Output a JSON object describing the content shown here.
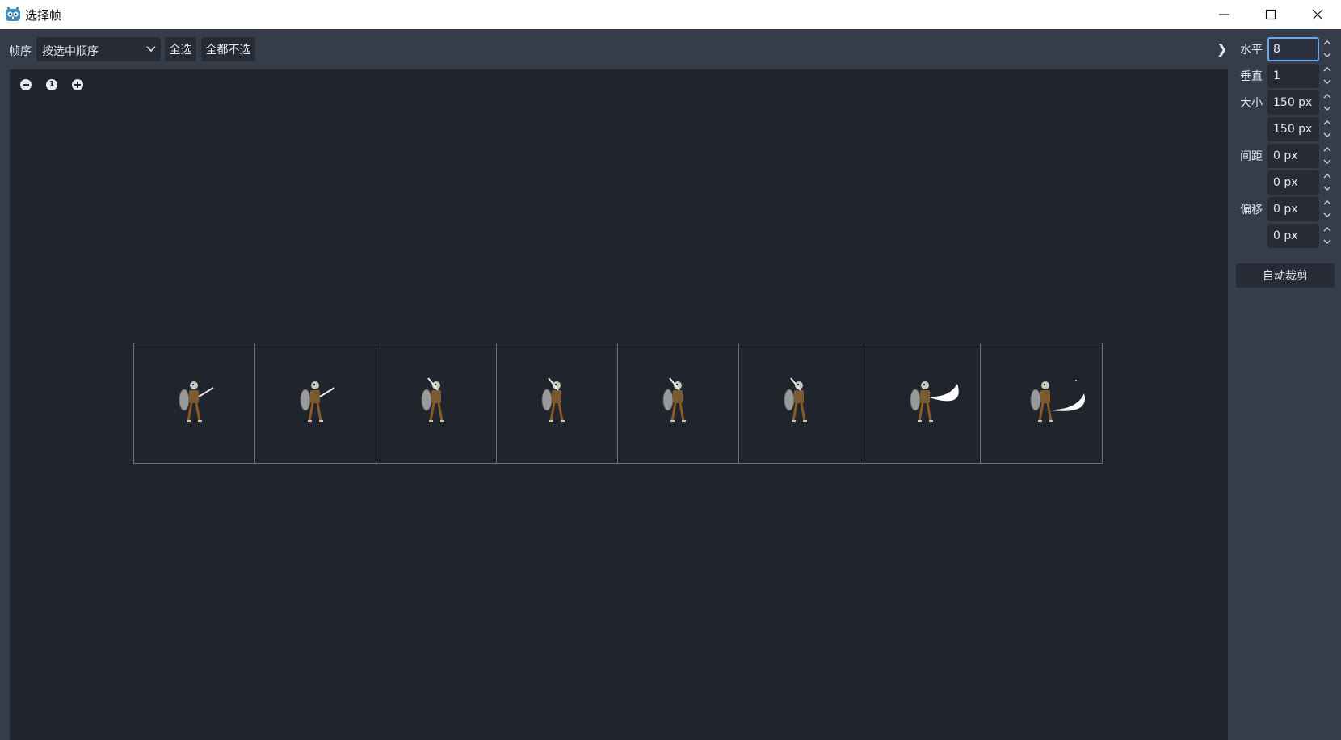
{
  "window": {
    "title": "选择帧",
    "app_icon": "godot-icon"
  },
  "toolbar": {
    "order_label": "帧序",
    "order_select_value": "按选中顺序",
    "select_all": "全选",
    "select_none": "全都不选",
    "collapse_glyph": "❯"
  },
  "zoom": {
    "out_icon": "zoom-out-icon",
    "reset_label": "1",
    "in_icon": "zoom-in-icon"
  },
  "frames": {
    "count": 8,
    "poses": [
      "idle-sword",
      "idle-sword",
      "sword-raised",
      "sword-raised",
      "sword-raised",
      "sword-raised",
      "slash-arc-large",
      "slash-arc-thin"
    ]
  },
  "panel": {
    "horizontal_label": "水平",
    "horizontal_value": "8",
    "vertical_label": "垂直",
    "vertical_value": "1",
    "size_label": "大小",
    "size_w": "150 px",
    "size_h": "150 px",
    "separation_label": "间距",
    "sep_x": "0 px",
    "sep_y": "0 px",
    "offset_label": "偏移",
    "off_x": "0 px",
    "off_y": "0 px",
    "autocrop": "自动裁剪"
  },
  "colors": {
    "background": "#363d4a",
    "canvas": "#20242d",
    "field": "#262b36",
    "focus_border": "#6ea8ea",
    "grid_line": "#6a6f7a"
  }
}
